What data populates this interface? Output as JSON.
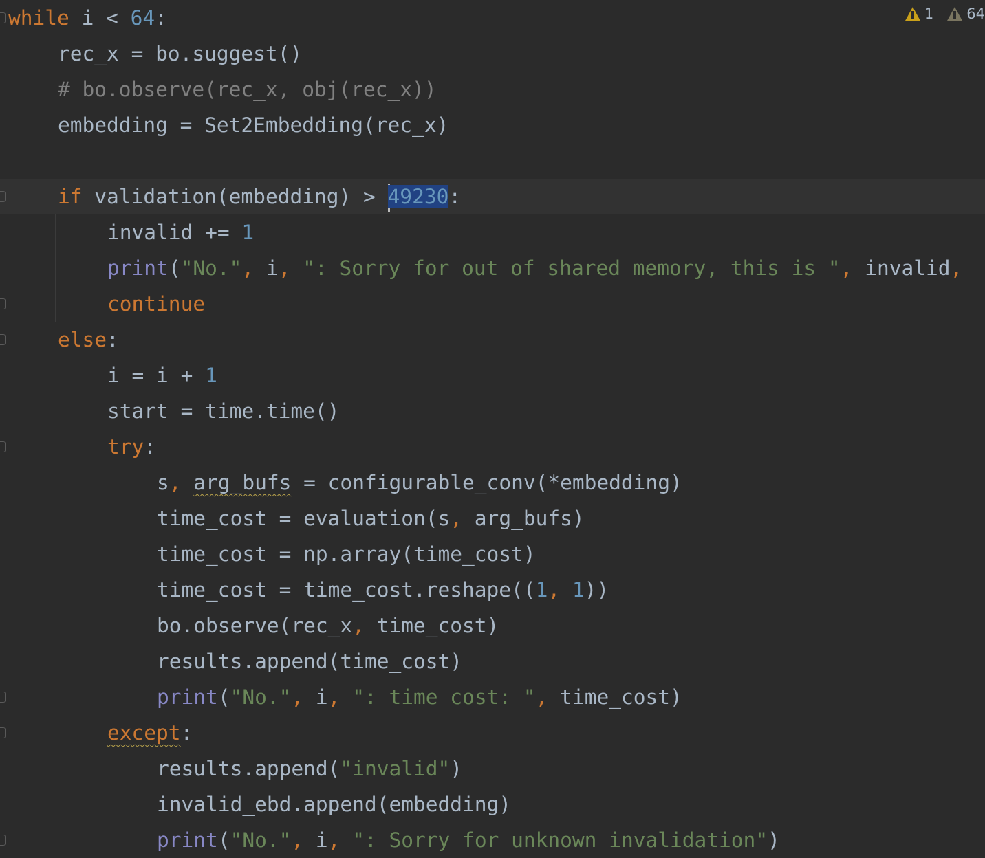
{
  "colors": {
    "background": "#2b2b2b",
    "current_line": "#323232",
    "selection": "#214283",
    "text": "#a9b7c6",
    "keyword": "#cc7832",
    "number": "#6897bb",
    "string": "#6a8759",
    "builtin": "#8888c6",
    "comment": "#808080"
  },
  "inspections": {
    "errors_icon": "warning-triangle-icon",
    "warnings": "1",
    "weak_warnings_icon": "weak-warning-triangle-icon",
    "weak_warnings": "64"
  },
  "current_line": 5,
  "lines": [
    {
      "indent": 0,
      "fold": true,
      "tokens": [
        [
          "while",
          "kw"
        ],
        " i < ",
        [
          "64",
          "num"
        ],
        ":"
      ]
    },
    {
      "indent": 1,
      "tokens": [
        "rec_x = bo.suggest()"
      ]
    },
    {
      "indent": 1,
      "tokens": [
        [
          "# bo.observe(rec_x, obj(rec_x))",
          "cm"
        ]
      ]
    },
    {
      "indent": 1,
      "tokens": [
        "embedding = Set2Embedding(rec_x)"
      ]
    },
    {
      "indent": 0,
      "tokens": []
    },
    {
      "indent": 1,
      "fold": true,
      "tokens": [
        [
          "if",
          "kw"
        ],
        " validation(embedding) > ",
        [
          "49230",
          "num sel caret"
        ],
        ":"
      ]
    },
    {
      "indent": 2,
      "tokens": [
        "invalid += ",
        [
          "1",
          "num"
        ]
      ]
    },
    {
      "indent": 2,
      "tokens": [
        [
          "print",
          "bi"
        ],
        "(",
        [
          "\"No.\"",
          "str"
        ],
        [
          ",",
          "pn"
        ],
        " i",
        [
          ",",
          "pn"
        ],
        " ",
        [
          "\": Sorry for out of shared memory, this is \"",
          "str"
        ],
        [
          ",",
          "pn"
        ],
        " invalid",
        [
          ",",
          "pn"
        ]
      ]
    },
    {
      "indent": 2,
      "fold": true,
      "tokens": [
        [
          "continue",
          "kw"
        ]
      ]
    },
    {
      "indent": 1,
      "fold": true,
      "tokens": [
        [
          "else",
          "kw"
        ],
        ":"
      ]
    },
    {
      "indent": 2,
      "tokens": [
        "i = i + ",
        [
          "1",
          "num"
        ]
      ]
    },
    {
      "indent": 2,
      "tokens": [
        "start = time.time()"
      ]
    },
    {
      "indent": 2,
      "fold": true,
      "tokens": [
        [
          "try",
          "kw"
        ],
        ":"
      ]
    },
    {
      "indent": 3,
      "tokens": [
        "s",
        [
          ",",
          "pn"
        ],
        " ",
        [
          "arg_bufs",
          "wavy"
        ],
        " = configurable_conv(*embedding)"
      ]
    },
    {
      "indent": 3,
      "tokens": [
        "time_cost = evaluation(s",
        [
          ",",
          "pn"
        ],
        " arg_bufs)"
      ]
    },
    {
      "indent": 3,
      "tokens": [
        "time_cost = np.array(time_cost)"
      ]
    },
    {
      "indent": 3,
      "tokens": [
        "time_cost = time_cost.reshape((",
        [
          "1",
          "num"
        ],
        [
          ",",
          "pn"
        ],
        " ",
        [
          "1",
          "num"
        ],
        "))"
      ]
    },
    {
      "indent": 3,
      "tokens": [
        "bo.observe(rec_x",
        [
          ",",
          "pn"
        ],
        " time_cost)"
      ]
    },
    {
      "indent": 3,
      "tokens": [
        "results.append(time_cost)"
      ]
    },
    {
      "indent": 3,
      "fold": true,
      "tokens": [
        [
          "print",
          "bi"
        ],
        "(",
        [
          "\"No.\"",
          "str"
        ],
        [
          ",",
          "pn"
        ],
        " i",
        [
          ",",
          "pn"
        ],
        " ",
        [
          "\": time cost: \"",
          "str"
        ],
        [
          ",",
          "pn"
        ],
        " time_cost)"
      ]
    },
    {
      "indent": 2,
      "fold": true,
      "tokens": [
        [
          "except",
          "kw wavy"
        ],
        ":"
      ]
    },
    {
      "indent": 3,
      "tokens": [
        "results.append(",
        [
          "\"invalid\"",
          "str"
        ],
        ")"
      ]
    },
    {
      "indent": 3,
      "tokens": [
        "invalid_ebd.append(embedding)"
      ]
    },
    {
      "indent": 3,
      "fold": true,
      "tokens": [
        [
          "print",
          "bi"
        ],
        "(",
        [
          "\"No.\"",
          "str"
        ],
        [
          ",",
          "pn"
        ],
        " i",
        [
          ",",
          "pn"
        ],
        " ",
        [
          "\": Sorry for unknown invalidation\"",
          "str"
        ],
        ")"
      ]
    }
  ]
}
